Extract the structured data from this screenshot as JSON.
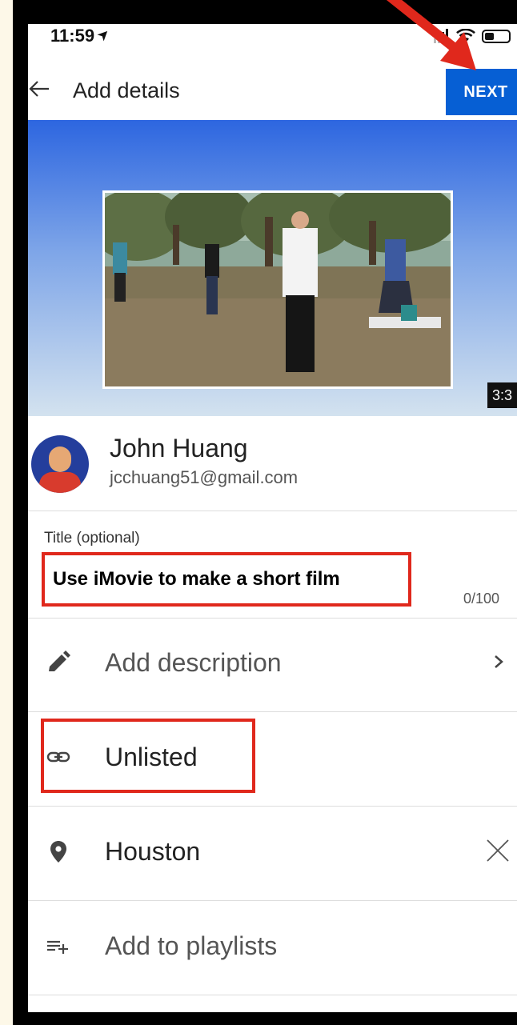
{
  "status_bar": {
    "time": "11:59"
  },
  "header": {
    "title": "Add details",
    "next_label": "NEXT"
  },
  "video": {
    "duration": "3:3"
  },
  "account": {
    "name": "John Huang",
    "email": "jcchuang51@gmail.com"
  },
  "title_field": {
    "label": "Title (optional)",
    "value": "Use iMovie to make a short film",
    "char_count": "0/100"
  },
  "rows": {
    "description": "Add description",
    "visibility": "Unlisted",
    "location": "Houston",
    "playlists": "Add to playlists"
  },
  "colors": {
    "accent": "#065fd4",
    "annotation": "#e0281c"
  },
  "icons": [
    "back-arrow-icon",
    "pencil-icon",
    "link-icon",
    "location-pin-icon",
    "playlist-add-icon",
    "chevron-right-icon",
    "close-icon"
  ]
}
